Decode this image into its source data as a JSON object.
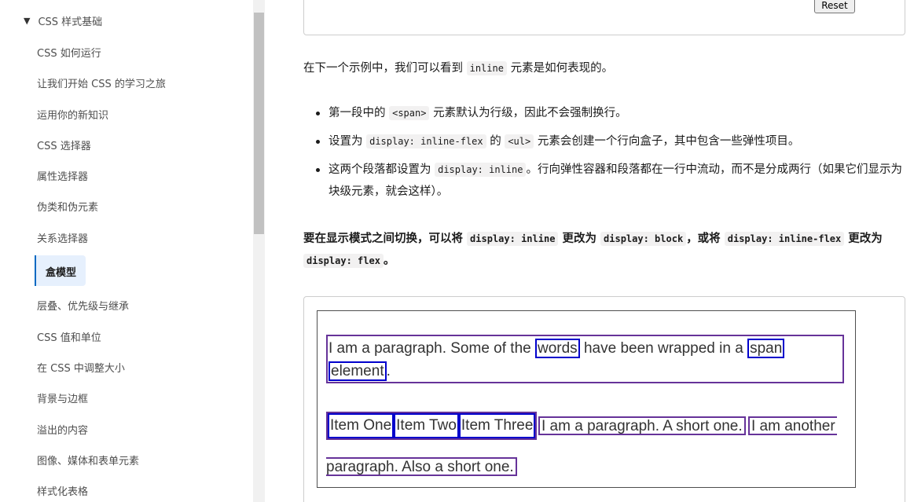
{
  "sidebar": {
    "section_toggle": "▼",
    "section_title": "CSS 样式基础",
    "items": [
      "CSS 如何运行",
      "让我们开始 CSS 的学习之旅",
      "运用你的新知识",
      "CSS 选择器",
      "属性选择器",
      "伪类和伪元素",
      "关系选择器",
      "盒模型",
      "层叠、优先级与继承",
      "CSS 值和单位",
      "在 CSS 中调整大小",
      "背景与边框",
      "溢出的内容",
      "图像、媒体和表单元素",
      "样式化表格"
    ],
    "active_item": "盒模型"
  },
  "main": {
    "reset_label": "Reset",
    "intro": {
      "before": "在下一个示例中，我们可以看到 ",
      "code": "inline",
      "after": " 元素是如何表现的。"
    },
    "bullets": [
      {
        "a": "第一段中的 ",
        "code1": "<span>",
        "b": " 元素默认为行级，因此不会强制换行。"
      },
      {
        "a": "设置为 ",
        "code1": "display: inline-flex",
        "b": " 的 ",
        "code2": "<ul>",
        "c": " 元素会创建一个行向盒子，其中包含一些弹性项目。"
      },
      {
        "a": "这两个段落都设置为 ",
        "code1": "display: inline",
        "b": "。行向弹性容器和段落都在一行中流动，而不是分成两行（如果它们显示为块级元素，就会这样）。"
      }
    ],
    "bold": {
      "a": "要在显示模式之间切换，可以将 ",
      "code1": "display: inline",
      "b": " 更改为 ",
      "code2": "display: block",
      "c": "，或将 ",
      "code3": "display: inline-flex",
      "d": " 更改为 ",
      "code4": "display: flex",
      "e": "。"
    },
    "example": {
      "p1_a": "I am a paragraph. Some of the ",
      "p1_span1": "words",
      "p1_b": " have been wrapped in a ",
      "p1_span2": "span",
      "p1_span2_cont": "element",
      "p1_c": ".",
      "list_items": [
        "Item One",
        "Item Two",
        "Item Three"
      ],
      "p2": "I am a paragraph. A short one.",
      "p3_line1": "I am another",
      "p3_line2": "paragraph. Also a short one."
    }
  }
}
